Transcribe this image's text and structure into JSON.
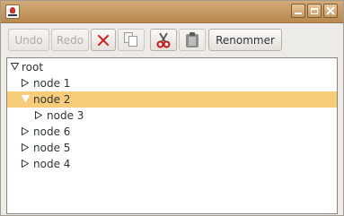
{
  "toolbar": {
    "undo_label": "Undo",
    "redo_label": "Redo",
    "rename_label": "Renommer",
    "delete_icon": "delete-x-icon",
    "copy_icon": "copy-icon",
    "cut_icon": "scissors-icon",
    "paste_icon": "clipboard-icon"
  },
  "colors": {
    "titlebar": "#c49a63",
    "selection": "#f7cd7b",
    "delete": "#cc1f1f",
    "cut": "#c21a1a"
  },
  "tree": {
    "root": "root",
    "node_1": "node 1",
    "node_2": "node 2",
    "node_3": "node 3",
    "node_6": "node 6",
    "node_5": "node 5",
    "node_4": "node 4"
  }
}
